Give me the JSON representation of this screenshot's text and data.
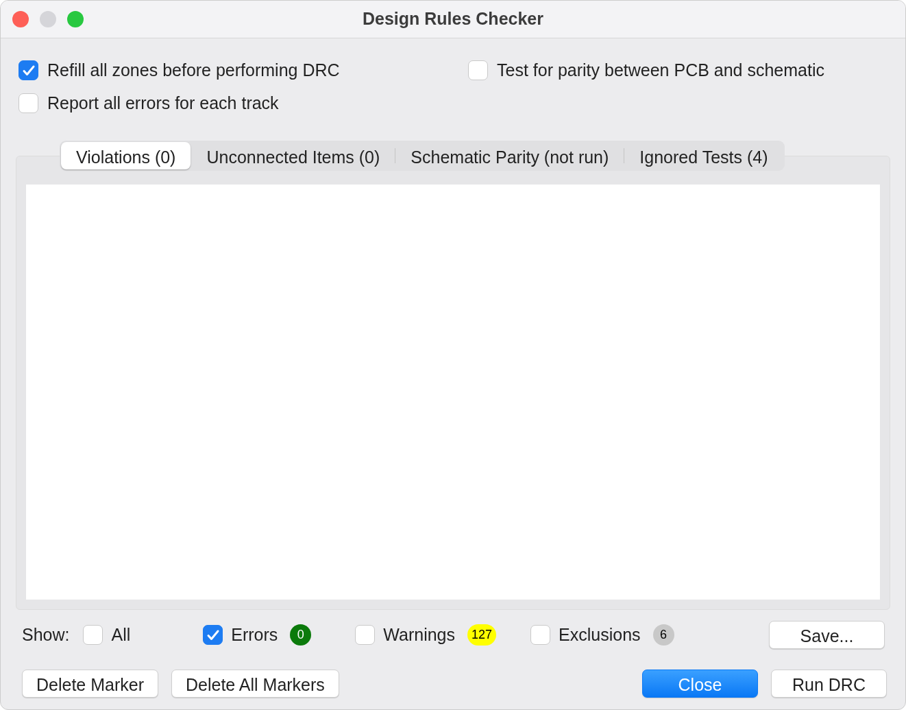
{
  "window": {
    "title": "Design Rules Checker"
  },
  "options": [
    {
      "label": "Refill all zones before performing DRC",
      "checked": true
    },
    {
      "label": "Test for parity between PCB and schematic",
      "checked": false
    },
    {
      "label": "Report all errors for each track",
      "checked": false
    }
  ],
  "tabs": [
    {
      "label": "Violations (0)",
      "selected": true
    },
    {
      "label": "Unconnected Items (0)",
      "selected": false
    },
    {
      "label": "Schematic Parity (not run)",
      "selected": false
    },
    {
      "label": "Ignored Tests (4)",
      "selected": false
    }
  ],
  "show_label": "Show:",
  "filters": [
    {
      "label": "All",
      "checked": false
    },
    {
      "label": "Errors",
      "checked": true,
      "count": "0",
      "color": "#0b7a0b"
    },
    {
      "label": "Warnings",
      "checked": false,
      "count": "127",
      "color": "#ffff00"
    },
    {
      "label": "Exclusions",
      "checked": false,
      "count": "6",
      "color": "#c8c8c8"
    }
  ],
  "save_button": "Save...",
  "buttons": [
    {
      "label": "Delete Marker",
      "kind": "default"
    },
    {
      "label": "Delete All Markers",
      "kind": "default"
    },
    {
      "label": "Close",
      "kind": "primary"
    },
    {
      "label": "Run DRC",
      "kind": "default"
    }
  ]
}
